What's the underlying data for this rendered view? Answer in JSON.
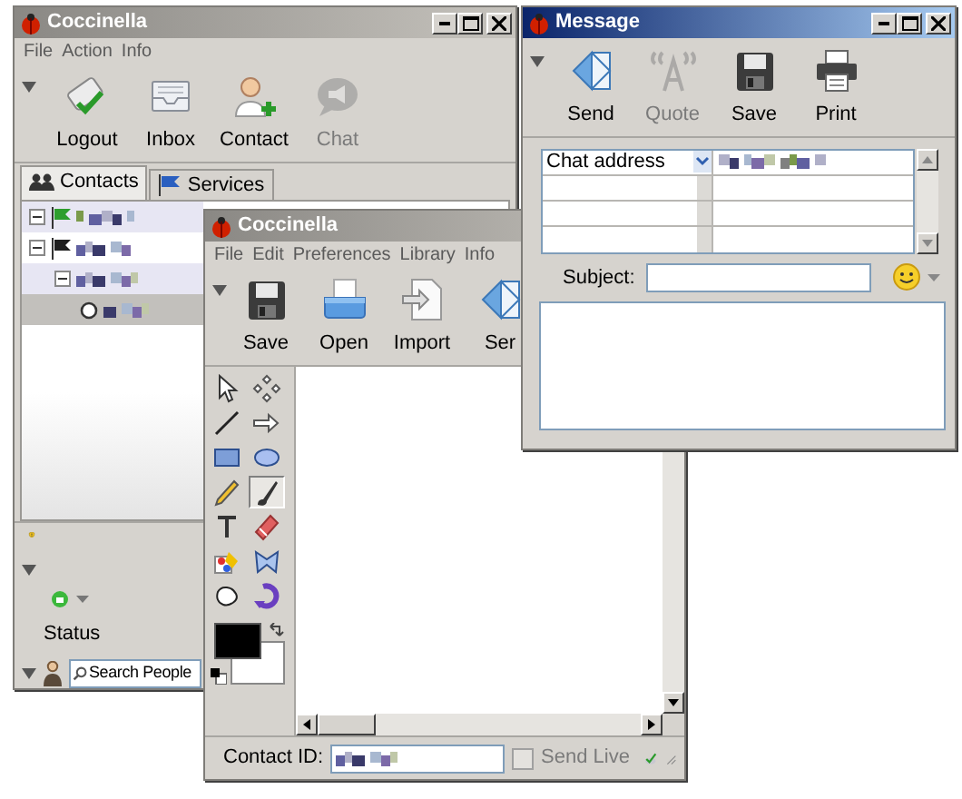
{
  "windows": [
    {
      "kind": "roster",
      "title": "Coccinella",
      "active": false,
      "menu": [
        "File",
        "Action",
        "Info"
      ],
      "toolbar": [
        {
          "kind": "logout",
          "label": "Logout",
          "disabled": false
        },
        {
          "kind": "inbox",
          "label": "Inbox",
          "disabled": false
        },
        {
          "kind": "contact",
          "label": "Contact",
          "disabled": false
        },
        {
          "kind": "chat",
          "label": "Chat",
          "disabled": true
        }
      ],
      "tabs": [
        {
          "kind": "contacts",
          "label": "Contacts",
          "selected": true
        },
        {
          "kind": "services",
          "label": "Services",
          "selected": false
        }
      ],
      "tree": [
        {
          "kind": "group",
          "color": "#2e9e2e",
          "expanded": true,
          "selected": false
        },
        {
          "kind": "group",
          "color": "#1e1e1e",
          "expanded": true,
          "selected": false,
          "children": [
            {
              "kind": "group",
              "expanded": true,
              "selected": false,
              "children": [
                {
                  "kind": "contact",
                  "selected": true
                }
              ]
            }
          ]
        }
      ],
      "status_label": "Status",
      "search": {
        "placeholder": "Search People"
      }
    },
    {
      "kind": "whiteboard",
      "title": "Coccinella",
      "active": false,
      "menu": [
        "File",
        "Edit",
        "Preferences",
        "Library",
        "Info"
      ],
      "toolbar": [
        {
          "kind": "save",
          "label": "Save",
          "disabled": false
        },
        {
          "kind": "open",
          "label": "Open",
          "disabled": false
        },
        {
          "kind": "import",
          "label": "Import",
          "disabled": false
        },
        {
          "kind": "send",
          "label": "Ser",
          "disabled": false
        }
      ],
      "tools": [
        {
          "kind": "select",
          "selected": false
        },
        {
          "kind": "move",
          "selected": false
        },
        {
          "kind": "line",
          "selected": false
        },
        {
          "kind": "arrow",
          "selected": false
        },
        {
          "kind": "rect",
          "selected": false
        },
        {
          "kind": "oval",
          "selected": false
        },
        {
          "kind": "pencil",
          "selected": false
        },
        {
          "kind": "brush",
          "selected": true
        },
        {
          "kind": "text",
          "selected": false
        },
        {
          "kind": "eraser",
          "selected": false
        },
        {
          "kind": "paint",
          "selected": false
        },
        {
          "kind": "polygon",
          "selected": false
        },
        {
          "kind": "freeform",
          "selected": false
        },
        {
          "kind": "rotate",
          "selected": false
        }
      ],
      "contact_id": {
        "label": "Contact ID:"
      },
      "send_live": {
        "label": "Send Live",
        "checked": false,
        "disabled": true
      }
    },
    {
      "kind": "message",
      "title": "Message",
      "active": true,
      "toolbar": [
        {
          "kind": "send",
          "label": "Send",
          "disabled": false
        },
        {
          "kind": "quote",
          "label": "Quote",
          "disabled": true
        },
        {
          "kind": "save",
          "label": "Save",
          "disabled": false
        },
        {
          "kind": "print",
          "label": "Print",
          "disabled": false
        }
      ],
      "address": {
        "type": "Chat address"
      },
      "subject": {
        "label": "Subject:"
      }
    }
  ]
}
